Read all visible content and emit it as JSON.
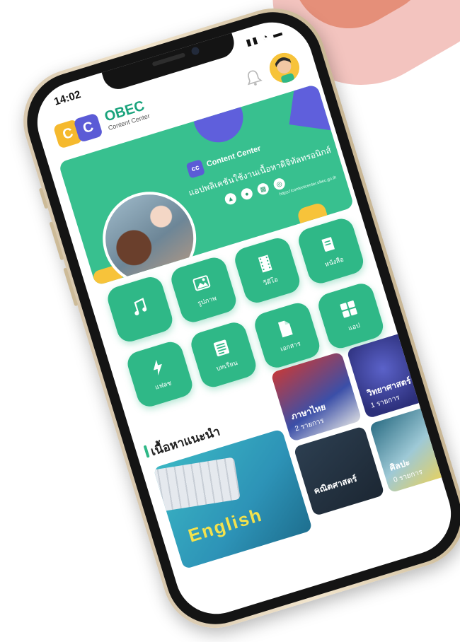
{
  "status": {
    "time": "14:02"
  },
  "app": {
    "logo_letters": [
      "C",
      "C"
    ],
    "name": "OBEC",
    "subtitle": "Content Center"
  },
  "banner": {
    "badge": "cc",
    "title": "Content Center",
    "tagline": "แอปพลิเคชันใช้งานเนื้อหาดิจิทัลทรอนิกส์",
    "store_icons": [
      "android",
      "apple",
      "windows",
      "web"
    ],
    "url": "https://contentcenter.obec.go.th"
  },
  "categories": [
    {
      "label": "",
      "icon": "music-icon"
    },
    {
      "label": "รูปภาพ",
      "icon": "image-icon"
    },
    {
      "label": "วีดีโอ",
      "icon": "film-icon"
    },
    {
      "label": "หนังสือ",
      "icon": "book-icon"
    },
    {
      "label": "แฟลช",
      "icon": "flash-icon"
    },
    {
      "label": "บทเรียน",
      "icon": "list-icon"
    },
    {
      "label": "เอกสาร",
      "icon": "document-icon"
    },
    {
      "label": "แอป",
      "icon": "apps-icon"
    }
  ],
  "section": {
    "title": "เนื้อหาแนะนำ"
  },
  "featured": {
    "text": "English"
  },
  "subjects": [
    {
      "name": "ภาษาไทย",
      "count": "2 รายการ"
    },
    {
      "name": "วิทยาศาสตร์",
      "count": "1 รายการ"
    },
    {
      "name": "คณิตศาสตร์",
      "count": ""
    },
    {
      "name": "ศิลปะ",
      "count": "0 รายการ"
    }
  ],
  "colors": {
    "brand_green": "#2fb887",
    "accent_purple": "#5f5fdc",
    "accent_yellow": "#f7c33a"
  }
}
